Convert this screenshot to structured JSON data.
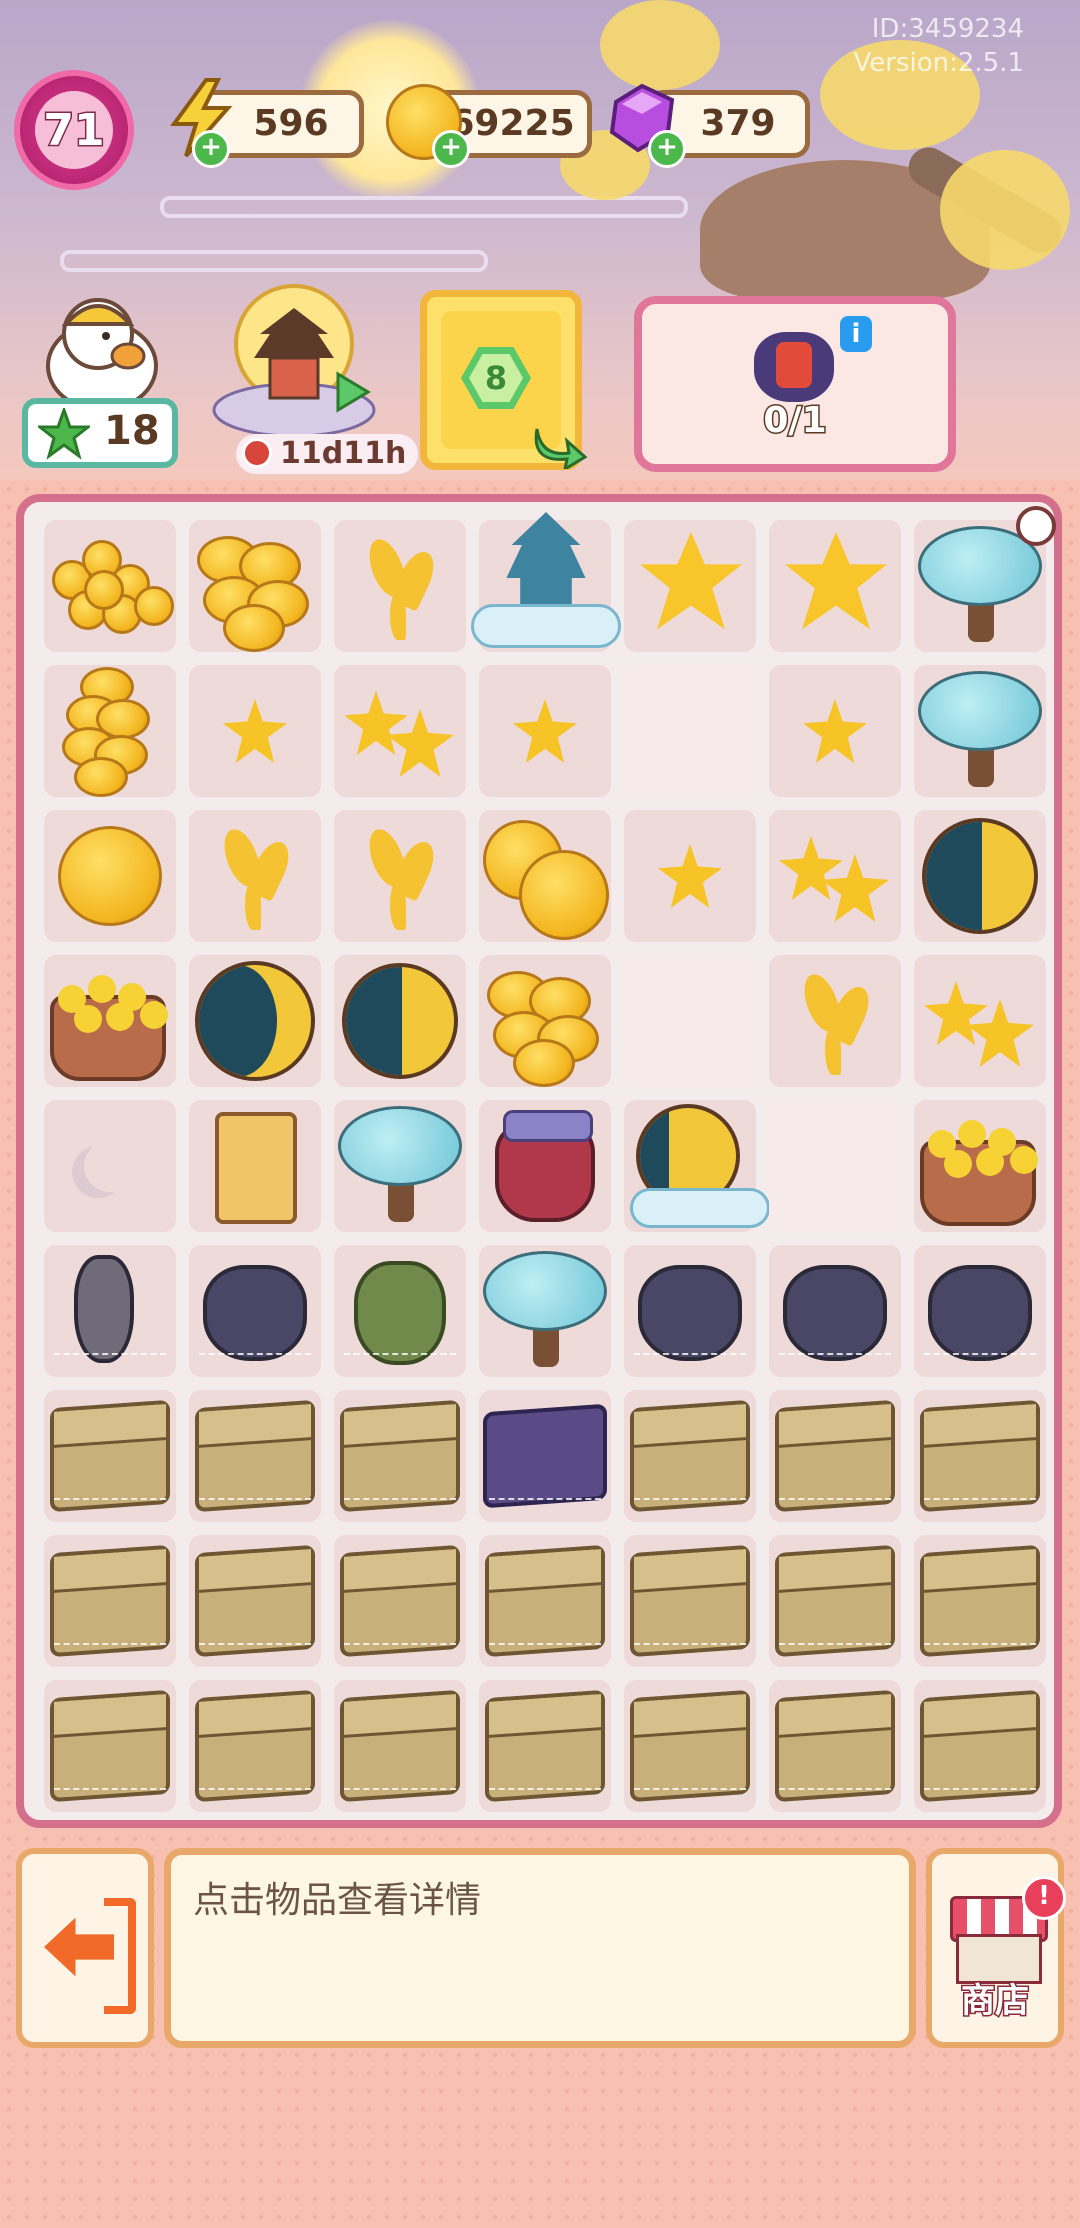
{
  "header": {
    "player_id": "ID:3459234",
    "version": "Version:2.5.1",
    "level": "71",
    "energy": "596",
    "coins": "69225",
    "gems": "379"
  },
  "quest": {
    "duck_stars": "18",
    "event_timer": "11d11h",
    "reward_progress": "0/1",
    "info_icon": "i",
    "card_deck_value": "8"
  },
  "board": {
    "rows": 9,
    "cols": 7,
    "items": [
      [
        "coin-pile",
        "coin-stack",
        "golden-sprig",
        "pagoda-island",
        "osmanthus-flower",
        "osmanthus-flower",
        "moon-tree"
      ],
      [
        "coin-tower",
        "petal-star",
        "petal-star-pair",
        "petal-star",
        "",
        "petal-star",
        "moon-tree"
      ],
      [
        "gold-coin",
        "golden-sprig",
        "golden-sprig",
        "coin-pair",
        "petal-star",
        "petal-star-pair",
        "half-moon"
      ],
      [
        "flower-basket",
        "crescent-moon",
        "half-moon",
        "coin-stack",
        "",
        "golden-sprig",
        "petal-star-pair"
      ],
      [
        "moon-placeholder",
        "lantern",
        "moon-tree",
        "honey-jar",
        "moon-cloud",
        "",
        "flower-basket"
      ],
      [
        "webbed-vase",
        "webbed-pot",
        "webbed-green-jar",
        "moon-tree",
        "webbed-pot",
        "webbed-pot",
        "webbed-pot"
      ],
      [
        "webbed-box",
        "webbed-box",
        "webbed-box",
        "webbed-purple-box",
        "webbed-box",
        "webbed-box",
        "webbed-box"
      ],
      [
        "webbed-box",
        "webbed-box",
        "webbed-box",
        "webbed-box",
        "webbed-box",
        "webbed-box",
        "webbed-box"
      ],
      [
        "webbed-box",
        "webbed-box",
        "webbed-box",
        "webbed-box",
        "webbed-box",
        "webbed-box",
        "webbed-box"
      ]
    ]
  },
  "footer": {
    "hint_text": "点击物品查看详情",
    "shop_label": "商店",
    "shop_alert": "!"
  }
}
